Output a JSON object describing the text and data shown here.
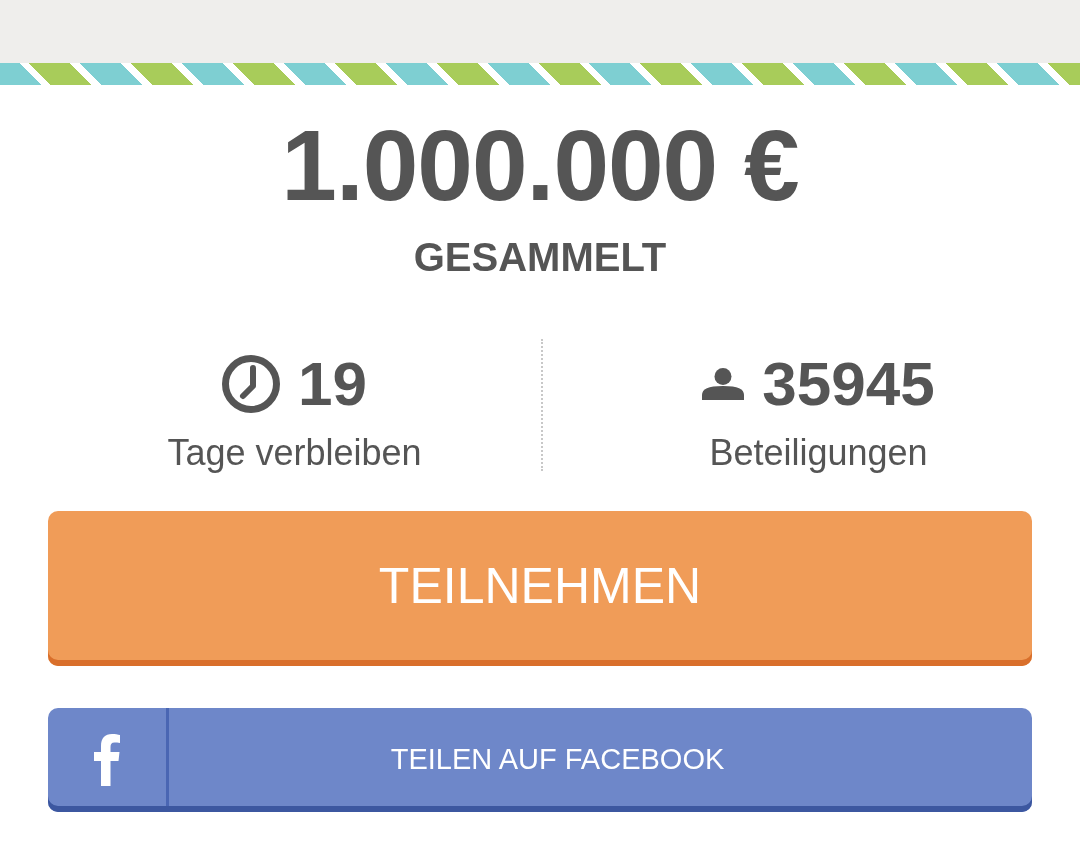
{
  "raised": {
    "amount": "1.000.000 €",
    "label": "GESAMMELT"
  },
  "stats": [
    {
      "kind": "clock",
      "value": "19",
      "label": "Tage verbleiben"
    },
    {
      "kind": "person",
      "value": "35945",
      "label": "Beteiligungen"
    }
  ],
  "buttons": [
    {
      "kind": "primary",
      "label": "TEILNEHMEN"
    },
    {
      "kind": "facebook",
      "label": "TEILEN AUF FACEBOOK"
    }
  ]
}
